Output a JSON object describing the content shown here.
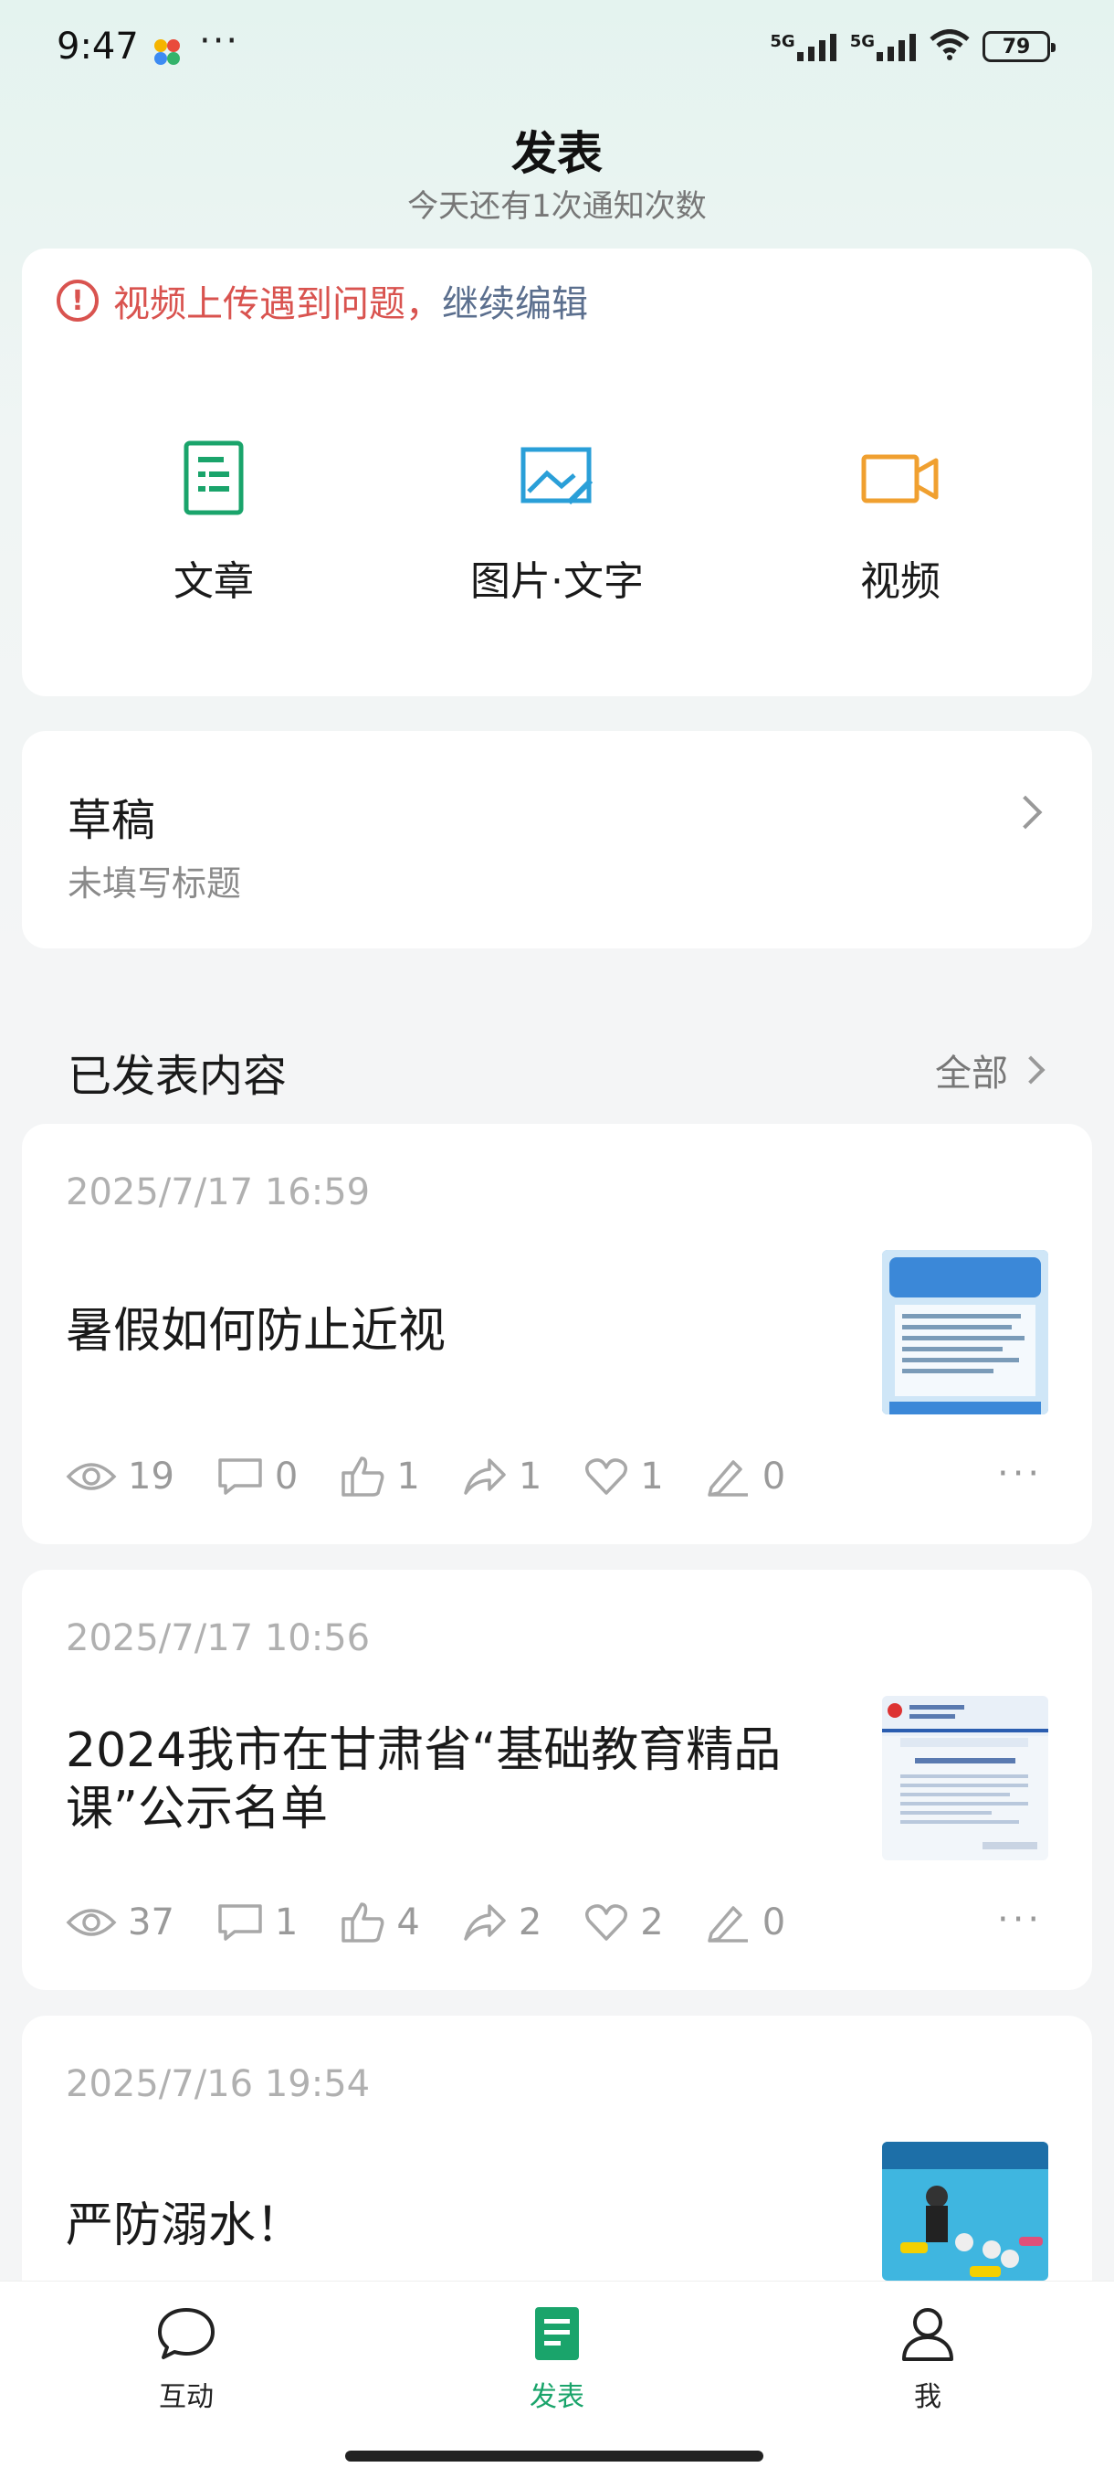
{
  "status_bar": {
    "time": "9:47",
    "dots": "···",
    "signal1": "5G",
    "signal2": "5G",
    "battery": "79"
  },
  "header": {
    "title": "发表",
    "subtitle": "今天还有1次通知次数"
  },
  "warning": {
    "icon": "!",
    "text": "视频上传遇到问题，",
    "link": "继续编辑"
  },
  "publish_options": [
    {
      "label": "文章",
      "icon": "article-icon",
      "color": "#1aa46b"
    },
    {
      "label": "图片·文字",
      "icon": "image-text-icon",
      "color": "#2a9fd8"
    },
    {
      "label": "视频",
      "icon": "video-icon",
      "color": "#f0a030"
    }
  ],
  "draft": {
    "title": "草稿",
    "subtitle": "未填写标题"
  },
  "published": {
    "title": "已发表内容",
    "all_label": "全部",
    "posts": [
      {
        "date": "2025/7/17 16:59",
        "title": "暑假如何防止近视",
        "stats": {
          "views": "19",
          "comments": "0",
          "likes": "1",
          "shares": "1",
          "favorites": "1",
          "edits": "0"
        }
      },
      {
        "date": "2025/7/17 10:56",
        "title": "2024我市在甘肃省“基础教育精品课”公示名单",
        "stats": {
          "views": "37",
          "comments": "1",
          "likes": "4",
          "shares": "2",
          "favorites": "2",
          "edits": "0"
        }
      },
      {
        "date": "2025/7/16 19:54",
        "title": "严防溺水！"
      }
    ]
  },
  "bottom_nav": [
    {
      "label": "互动",
      "icon": "chat-icon"
    },
    {
      "label": "发表",
      "icon": "publish-icon",
      "active": true
    },
    {
      "label": "我",
      "icon": "profile-icon"
    }
  ],
  "colors": {
    "accent": "#1aa46b",
    "warning": "#d9534f",
    "link": "#5b6f8e"
  }
}
